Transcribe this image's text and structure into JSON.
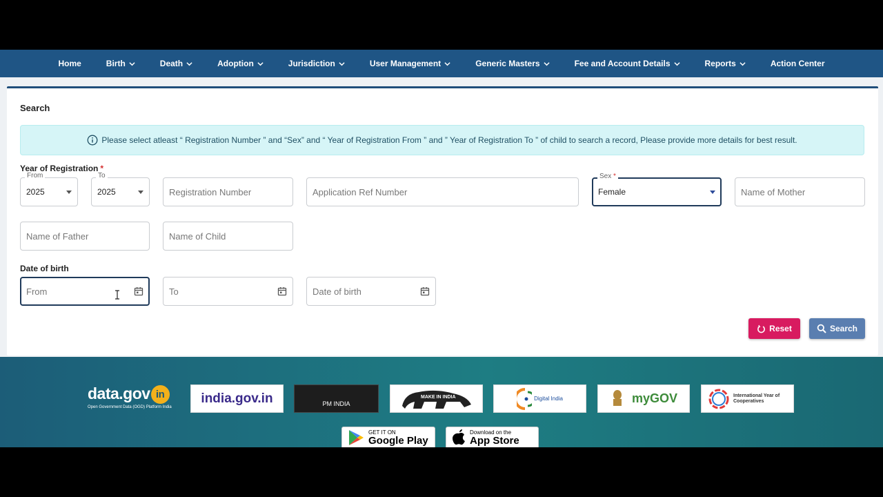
{
  "nav": {
    "items": [
      {
        "label": "Home",
        "dropdown": false
      },
      {
        "label": "Birth",
        "dropdown": true
      },
      {
        "label": "Death",
        "dropdown": true
      },
      {
        "label": "Adoption",
        "dropdown": true
      },
      {
        "label": "Jurisdiction",
        "dropdown": true
      },
      {
        "label": "User Management",
        "dropdown": true
      },
      {
        "label": "Generic Masters",
        "dropdown": true
      },
      {
        "label": "Fee and Account Details",
        "dropdown": true
      },
      {
        "label": "Reports",
        "dropdown": true
      },
      {
        "label": "Action Center",
        "dropdown": false
      }
    ]
  },
  "search": {
    "title": "Search",
    "info": "Please select atleast “ Registration Number ” and “Sex” and “ Year of Registration From ” and ” Year of Registration To ” of child to search a record, Please provide more details for best result.",
    "year_label": "Year of Registration",
    "required_mark": "*",
    "year_from_label": "From",
    "year_from_value": "2025",
    "year_to_label": "To",
    "year_to_value": "2025",
    "registration_number_placeholder": "Registration Number",
    "application_ref_placeholder": "Application Ref Number",
    "sex_label": "Sex",
    "sex_value": "Female",
    "mother_placeholder": "Name of Mother",
    "father_placeholder": "Name of Father",
    "child_placeholder": "Name of Child",
    "dob_label": "Date of birth",
    "dob_from_placeholder": "From",
    "dob_to_placeholder": "To",
    "dob_placeholder": "Date of birth",
    "reset_label": "Reset",
    "search_label": "Search"
  },
  "footer": {
    "datagov_title": "data.gov",
    "datagov_in": "in",
    "datagov_sub": "Open Government Data (OGD) Platform India",
    "logos": [
      "india.gov.in",
      "PM INDIA",
      "MAKE IN INDIA",
      "Digital India",
      "myGOV",
      "International Year of Cooperatives"
    ],
    "google_play_small": "GET IT ON",
    "google_play_big": "Google Play",
    "app_store_small": "Download on the",
    "app_store_big": "App Store"
  },
  "colors": {
    "nav_bg": "#1f5585",
    "reset": "#d81b60",
    "search": "#5a7eb0",
    "info_bg": "#d6f5f7"
  }
}
